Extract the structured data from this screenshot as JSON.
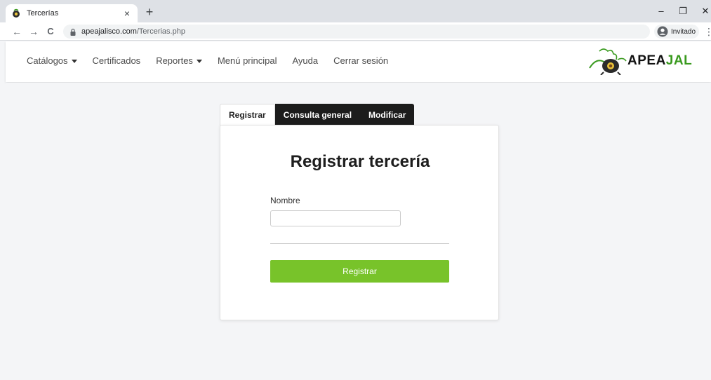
{
  "browser": {
    "tab_title": "Tercerías",
    "tab_close": "×",
    "new_tab": "+",
    "nav_back": "←",
    "nav_forward": "→",
    "nav_reload": "C",
    "url_host": "apeajalisco.com",
    "url_path": "/Tercerias.php",
    "profile_label": "Invitado",
    "menu_dots": "⋮",
    "window_minimize": "–",
    "window_restore": "❐",
    "window_close": "✕"
  },
  "navbar": {
    "items": [
      {
        "label": "Catálogos",
        "dropdown": true
      },
      {
        "label": "Certificados",
        "dropdown": false
      },
      {
        "label": "Reportes",
        "dropdown": true
      },
      {
        "label": "Menú principal",
        "dropdown": false
      },
      {
        "label": "Ayuda",
        "dropdown": false
      },
      {
        "label": "Cerrar sesión",
        "dropdown": false
      }
    ],
    "logo_prefix": "APEA",
    "logo_suffix": "JAL"
  },
  "form_tabs": [
    {
      "label": "Registrar",
      "active": true
    },
    {
      "label": "Consulta general",
      "active": false
    },
    {
      "label": "Modificar",
      "active": false
    }
  ],
  "form": {
    "title": "Registrar tercería",
    "name_label": "Nombre",
    "name_value": "",
    "name_placeholder": "",
    "submit_label": "Registrar"
  },
  "colors": {
    "accent_green": "#78c32a",
    "logo_green": "#3a9a1f",
    "dark_tab": "#1c1c1c"
  }
}
